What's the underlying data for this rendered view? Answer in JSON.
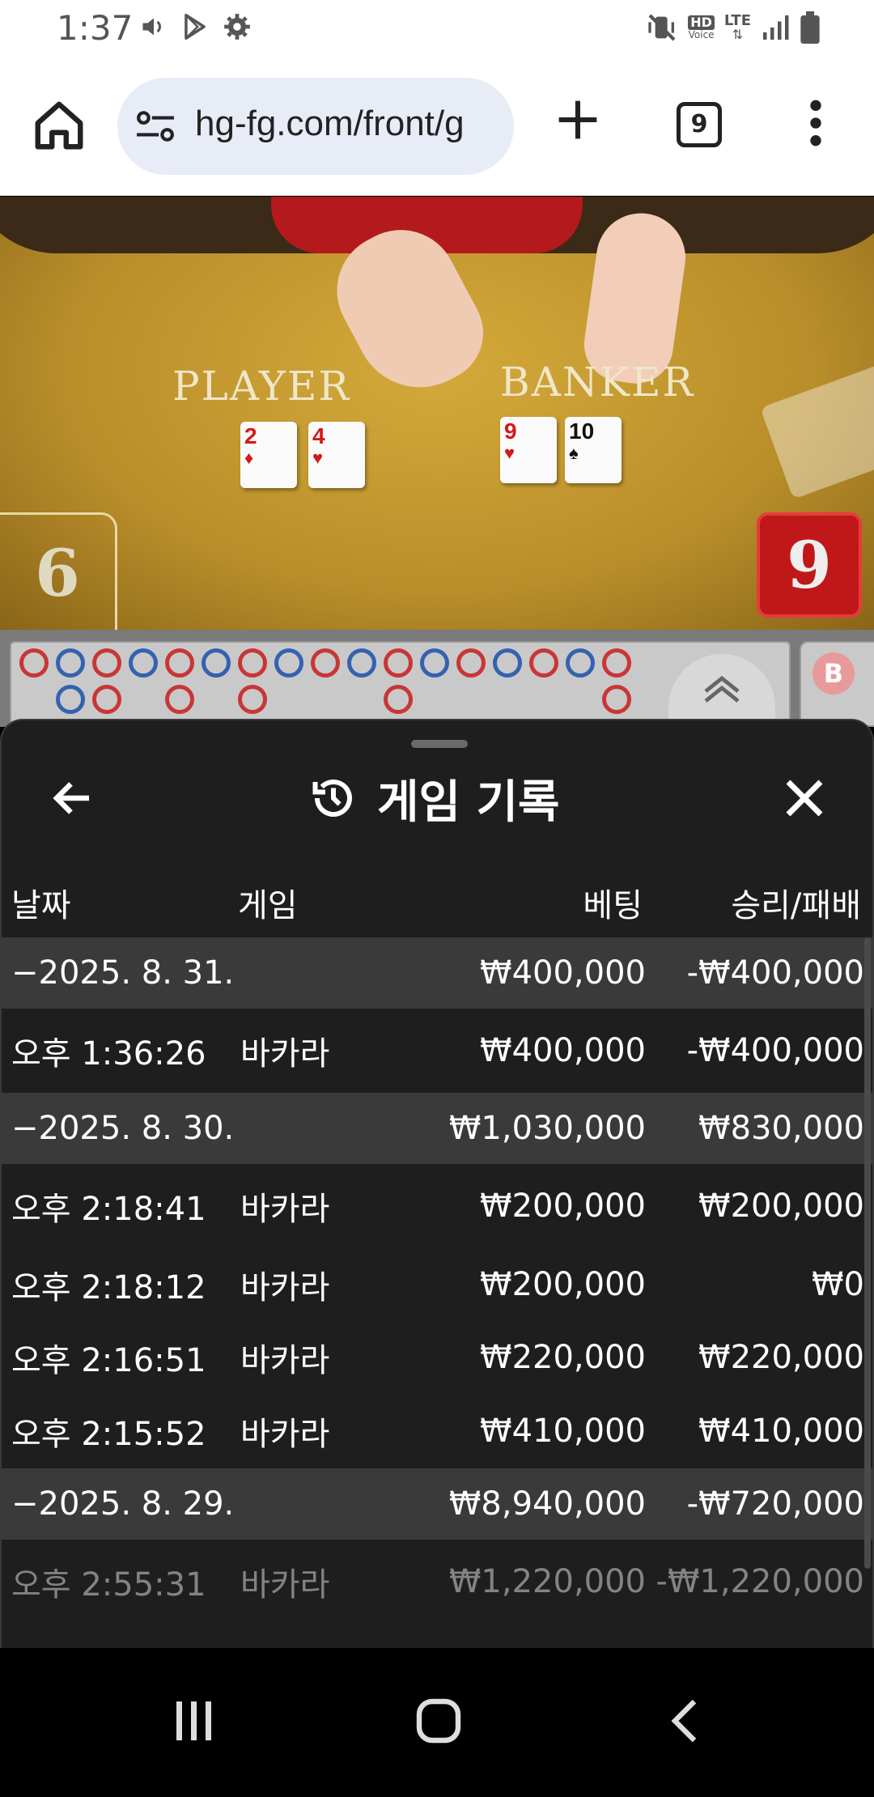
{
  "status": {
    "time": "1:37",
    "network": "LTE",
    "hd_voice": "HD",
    "voice_label": "Voice"
  },
  "browser": {
    "url": "hg-fg.com/front/g",
    "tab_count": "9"
  },
  "game": {
    "player_label": "PLAYER",
    "banker_label": "BANKER",
    "player_score": "6",
    "banker_score": "9",
    "player_cards": [
      {
        "rank": "2",
        "suit": "♦",
        "color": "red"
      },
      {
        "rank": "4",
        "suit": "♥",
        "color": "red"
      }
    ],
    "banker_cards": [
      {
        "rank": "9",
        "suit": "♥",
        "color": "red"
      },
      {
        "rank": "10",
        "suit": "♠",
        "color": "black"
      }
    ],
    "road_badge": "B",
    "road_top": [
      "red",
      "blue",
      "red",
      "blue",
      "red",
      "blue",
      "red",
      "blue",
      "red",
      "blue",
      "red",
      "blue",
      "red",
      "blue",
      "red",
      "blue",
      "red"
    ],
    "road_bottom": [
      "",
      "blue",
      "red",
      "",
      "red",
      "",
      "red",
      "",
      "",
      "",
      "red",
      "",
      "",
      "",
      "",
      "",
      "red"
    ]
  },
  "history": {
    "title": "게임 기록",
    "columns": {
      "date": "날짜",
      "game": "게임",
      "bet": "베팅",
      "result": "승리/패배"
    },
    "groups": [
      {
        "date": "−2025. 8. 31.",
        "bet": "₩400,000",
        "result": "-₩400,000",
        "items": [
          {
            "time": "오후 1:36:26",
            "game": "바카라",
            "bet": "₩400,000",
            "result": "-₩400,000"
          }
        ]
      },
      {
        "date": "−2025. 8. 30.",
        "bet": "₩1,030,000",
        "result": "₩830,000",
        "items": [
          {
            "time": "오후 2:18:41",
            "game": "바카라",
            "bet": "₩200,000",
            "result": "₩200,000"
          },
          {
            "time": "오후 2:18:12",
            "game": "바카라",
            "bet": "₩200,000",
            "result": "₩0"
          },
          {
            "time": "오후 2:16:51",
            "game": "바카라",
            "bet": "₩220,000",
            "result": "₩220,000"
          },
          {
            "time": "오후 2:15:52",
            "game": "바카라",
            "bet": "₩410,000",
            "result": "₩410,000"
          }
        ]
      },
      {
        "date": "−2025. 8. 29.",
        "bet": "₩8,940,000",
        "result": "-₩720,000",
        "items": [
          {
            "time": "오후 2:55:31",
            "game": "바카라",
            "bet": "₩1,220,000",
            "result": "-₩1,220,000"
          }
        ]
      }
    ]
  },
  "colors": {
    "sheet_bg": "#1e1e1e",
    "group_row_bg": "#3a3a3a",
    "banker_red": "#c01818",
    "road_red": "#c93636",
    "road_blue": "#3462b0"
  }
}
